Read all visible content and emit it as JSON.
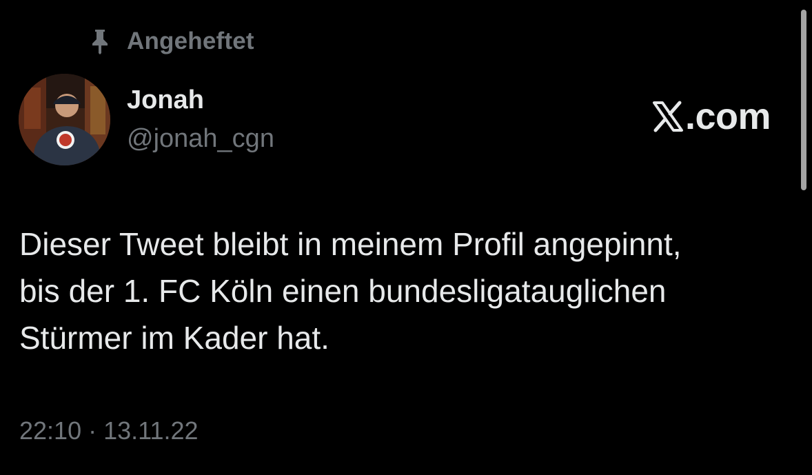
{
  "pinned": {
    "label": "Angeheftet",
    "icon": "pin-icon"
  },
  "author": {
    "name": "Jonah",
    "handle": "@jonah_cgn",
    "avatar_icon": "avatar-photo"
  },
  "watermark": {
    "text": "X.com",
    "logo_text": "",
    "suffix": ".com"
  },
  "tweet": {
    "text": "Dieser Tweet bleibt in meinem Profil angepinnt,\nbis der 1. FC Köln einen bundesligatauglichen\nStürmer im Kader hat.",
    "timestamp": "22:10 · 13.11.22"
  },
  "colors": {
    "background": "#000000",
    "primary_text": "#e7e9ea",
    "secondary_text": "#71767b"
  }
}
